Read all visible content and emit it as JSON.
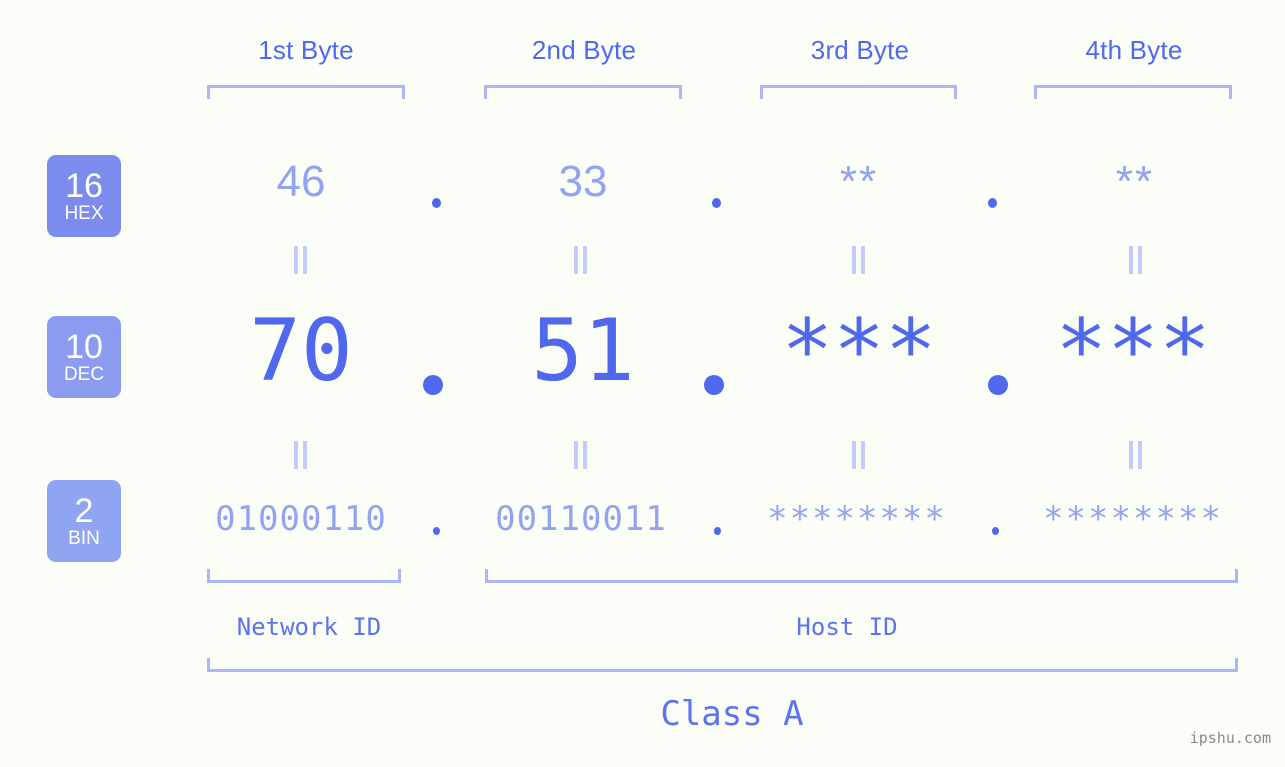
{
  "page": {
    "background_color": "#fbfdf7",
    "accent_color": "#4f68ee",
    "muted_accent_color": "#93a3f4",
    "bracket_color": "#aab6f7"
  },
  "byte_headers": [
    {
      "label": "1st Byte"
    },
    {
      "label": "2nd Byte"
    },
    {
      "label": "3rd Byte"
    },
    {
      "label": "4th Byte"
    }
  ],
  "bases": [
    {
      "number": "16",
      "abbr": "HEX",
      "color": "#7b8ced"
    },
    {
      "number": "10",
      "abbr": "DEC",
      "color": "#8b9bf0"
    },
    {
      "number": "2",
      "abbr": "BIN",
      "color": "#90a5f2"
    }
  ],
  "rows": {
    "hex": {
      "base_number": "16",
      "base_abbr": "HEX",
      "values": [
        "46",
        "33",
        "**",
        "**"
      ],
      "separator": "."
    },
    "dec": {
      "base_number": "10",
      "base_abbr": "DEC",
      "values": [
        "70",
        "51",
        "***",
        "***"
      ],
      "separator": "."
    },
    "bin": {
      "base_number": "2",
      "base_abbr": "BIN",
      "values": [
        "01000110",
        "00110011",
        "********",
        "********"
      ],
      "separator": "."
    }
  },
  "equals_symbol": "‖",
  "id_labels": {
    "network": "Network ID",
    "host": "Host ID"
  },
  "class_label": "Class A",
  "watermark": "ipshu.com"
}
